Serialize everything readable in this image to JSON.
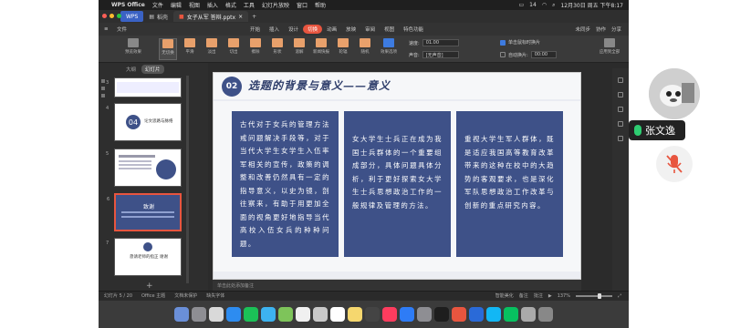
{
  "menubar": {
    "app": "WPS Office",
    "items": [
      "文件",
      "编辑",
      "视图",
      "插入",
      "格式",
      "工具",
      "幻灯片放映",
      "窗口",
      "帮助"
    ],
    "battery": "14",
    "datetime": "12月30日 周五 下午8:17"
  },
  "tabs": {
    "wps": "WPS",
    "home": "稻壳",
    "doc": "女子从军 答辩.pptx"
  },
  "ribbon_tabs": {
    "file": "文件",
    "items": [
      "开始",
      "插入",
      "设计",
      "切换",
      "动画",
      "放映",
      "审阅",
      "视图",
      "特色功能"
    ],
    "selected_index": 3,
    "tools": [
      "未同步",
      "协作",
      "分享"
    ]
  },
  "ribbon": {
    "preview": "预览效果",
    "transitions": [
      "无切换",
      "平滑",
      "淡出",
      "切出",
      "擦除",
      "形状",
      "溶解",
      "新闻快报",
      "轮辐",
      "随机"
    ],
    "effects_label": "效果选项",
    "speed_label": "速度:",
    "speed_value": "01.00",
    "sound_label": "声音:",
    "sound_value": "[无声音]",
    "on_click_label": "单击鼠标时换片",
    "auto_label": "自动换片:",
    "auto_value": "00:00",
    "apply_all": "应用到全部"
  },
  "leftpanel": {
    "outline": "大纲",
    "slides": "幻灯片",
    "thumbs": [
      {
        "n": "3",
        "text": ""
      },
      {
        "n": "4",
        "text": "论文思路与脉络"
      },
      {
        "n": "5",
        "text": ""
      },
      {
        "n": "6",
        "text": "致谢"
      },
      {
        "n": "7",
        "text": "恳请老师的指正 谢谢"
      }
    ]
  },
  "slide": {
    "badge": "02",
    "title": "选题的背景与意义——意义",
    "cards": [
      "古代对于女兵的管理方法戒问题解决手段等，对于当代大学生女学生入伍率军相关的宣传，政策的调整和改善仍然具有一定的指导意义，以史为镜，剖往察来，有助于用更加全面的视角更好地指导当代高校入伍女兵的种种问题。",
      "女大学生士兵正在成为我国士兵群体的一个重要组成部分，具体问题具体分析，利于更好探索女大学生士兵思想政治工作的一般规律及管理的方法。",
      "重视大学生军人群体，既是适应我国高等教育改革带来的这种在校中的大趋势的客观要求，也是深化军队思想政治工作改革与创新的重点研究内容。"
    ]
  },
  "notes": "单击此处添加备注",
  "status": {
    "slide_pos": "幻灯片 5 / 20",
    "theme": "Office 主题",
    "backup": "文档未保护",
    "font": "缺失字体",
    "beautify": "智能美化",
    "notes_btn": "备注",
    "comment": "批注",
    "zoom": "137%"
  },
  "call": {
    "name": "张文逸"
  },
  "colors": {
    "navy": "#3e5188",
    "accent": "#e8553f",
    "mic_green": "#2ecc71"
  }
}
